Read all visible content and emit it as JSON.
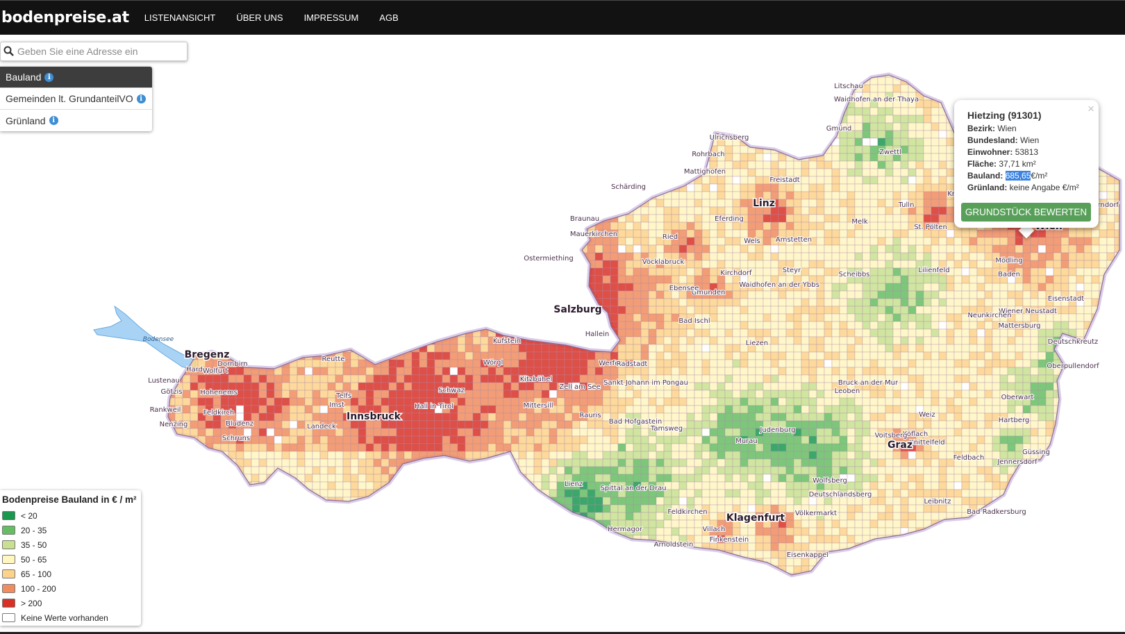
{
  "navbar": {
    "brand": "bodenpreise.at",
    "links": [
      "LISTENANSICHT",
      "ÜBER UNS",
      "IMPRESSUM",
      "AGB"
    ]
  },
  "search": {
    "placeholder": "Geben Sie eine Adresse ein"
  },
  "layers": [
    {
      "label": "Bauland",
      "active": true
    },
    {
      "label": "Gemeinden lt. GrundanteilVO",
      "active": false
    },
    {
      "label": "Grünland",
      "active": false
    }
  ],
  "legend": {
    "title": "Bodenpreise Bauland in € / m²",
    "items": [
      {
        "label": "< 20",
        "color": "#1a9850"
      },
      {
        "label": "20 - 35",
        "color": "#66bd63"
      },
      {
        "label": "35 - 50",
        "color": "#c8e08f"
      },
      {
        "label": "50 - 65",
        "color": "#fff6c0"
      },
      {
        "label": "65 - 100",
        "color": "#fdd28a"
      },
      {
        "label": "100 - 200",
        "color": "#f08c5e"
      },
      {
        "label": "> 200",
        "color": "#d73027"
      },
      {
        "label": "Keine Werte vorhanden",
        "color": "#ffffff"
      }
    ]
  },
  "popup": {
    "title": "Hietzing (91301)",
    "close": "×",
    "fields": [
      {
        "label": "Bezirk:",
        "value": "Wien",
        "unit": ""
      },
      {
        "label": "Bundesland:",
        "value": "Wien",
        "unit": ""
      },
      {
        "label": "Einwohner:",
        "value": "53813",
        "unit": ""
      },
      {
        "label": "Fläche:",
        "value": "37,71 km²",
        "unit": ""
      },
      {
        "label": "Bauland:",
        "value": "685,65",
        "unit": "€/m²"
      },
      {
        "label": "Grünland:",
        "value": "keine Angabe €/m²",
        "unit": ""
      }
    ],
    "button": "GRUNDSTÜCK BEWERTEN"
  },
  "map": {
    "lake_label": "Bodensee",
    "cities_major": [
      "Linz",
      "Salzburg",
      "Innsbruck",
      "Graz",
      "Klagenfurt",
      "Wien",
      "Bregenz"
    ],
    "places": [
      "Litschau",
      "Waidhofen an der Thaya",
      "Gmünd",
      "Zwettl",
      "Ulrichsberg",
      "Rohrbach",
      "Schärding",
      "Braunau",
      "Freistadt",
      "Eferding",
      "Ried",
      "Wels",
      "Steyr",
      "Amstetten",
      "Melk",
      "Krems",
      "St. Pölten",
      "Tulln",
      "Mödling",
      "Baden",
      "Eisenstadt",
      "Wiener Neustadt",
      "Mattersburg",
      "Oberpullendorf",
      "Oberwart",
      "Hartberg",
      "Güssing",
      "Jennersdorf",
      "Feldbach",
      "Leibnitz",
      "Deutschlandsberg",
      "Wolfsberg",
      "Völkermarkt",
      "Villach",
      "Feldkirchen",
      "Spittal an der Drau",
      "Hermagor",
      "Lienz",
      "Tamsweg",
      "Murau",
      "Judenburg",
      "Leoben",
      "Bruck an der Mur",
      "Liezen",
      "Gmunden",
      "Vöcklabruck",
      "Kirchdorf",
      "Hallein",
      "Kufstein",
      "Kitzbühel",
      "Zell am See",
      "Sankt Johann im Pongau",
      "Schwaz",
      "Imst",
      "Landeck",
      "Reutte",
      "Bludenz",
      "Feldkirch",
      "Dornbirn",
      "Lustenau",
      "Rankweil",
      "Hohenems",
      "Götzis",
      "Hard",
      "Wolfurt",
      "Nenzing",
      "Schruns",
      "Telfs",
      "Hall in Tirol",
      "Wörgl",
      "Mittersill",
      "Werfen",
      "Radstadt",
      "Rauris",
      "Bad Hofgastein",
      "Bad Ischl",
      "Ebensee",
      "Waidhofen an der Ybbs",
      "Scheibbs",
      "Lilienfeld",
      "Neunkirchen",
      "Weiz",
      "Köflach",
      "Voitsberg",
      "Knittelfeld",
      "Eisenkappel",
      "Arnoldstein",
      "Finkenstein",
      "Bad Radkersburg",
      "Deutschkreutz",
      "Ostermiething",
      "Mauerkirchen",
      "Mattighofen",
      "Gänserndorf"
    ]
  }
}
